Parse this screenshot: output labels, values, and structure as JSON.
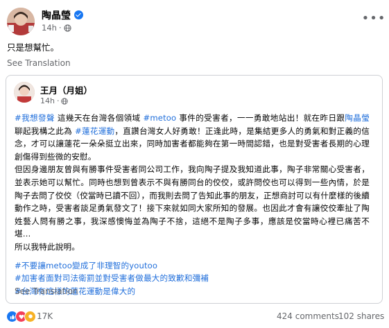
{
  "post": {
    "author": "陶晶瑩",
    "time": "14h",
    "text": "只是想幫忙。",
    "see_translation": "See Translation"
  },
  "shared": {
    "author": "王月（月姐）",
    "time": "14h",
    "body": {
      "p1": {
        "hashtag_1": "#我想發聲",
        "t1": " 這幾天在台灣各個領域 ",
        "hashtag_2": "#metoo",
        "t2": " 事件的受害者，一一勇敢地站出！就在昨日跟",
        "mention": "陶晶瑩",
        "t3": " 聊起我構之此為 ",
        "hashtag_3": "#蓮花運動",
        "t4": "，直讚台灣女人好勇敢！正逢此時，是集結更多人的勇氣和對正義的信念，才可以讓蓮花一朵朵挺立出來，同時加害者都能夠在第一時間認錯，也是對受害者長期的心理創傷得到些微的安慰。"
      },
      "p2": "但因身邊朋友曾與有勝事件受害者同公司工作，我向陶子提及我知道此事，陶子非常關心受害者，並表示她可以幫忙。同時也想到曾表示不與有勝同台的佼佼，或許問佼也可以得到一些內情，於是陶子去問了佼佼（佼當時已讀不回），而我則去問了告知此事的朋友，正想商討可以有什麼樣的後續動作之時，受害者談足勇氣發文了！接下來就如同大家所知的發展。也因此才會有讓佼佼牽扯了陶姓藝人問有勝之事，我深感懊悔並為陶子不捨，這絕不是陶子多事，應該是佼當時心裡已痛苦不堪…",
      "p3": "所以我特此說明。",
      "hashtags": [
        "#不要讓metoo變成了非理智的youtoo",
        "#加害者面對司法衛罰並對受害者做最大的致歉和彌補",
        "#台灣有這樣的蓮花運動是偉大的"
      ]
    },
    "see_translation": "See Translation"
  },
  "footer": {
    "reactions_count": "17K",
    "comments": "424 comments",
    "shares": "102 shares",
    "reaction_icons": [
      "like-icon",
      "heart-icon",
      "care-icon"
    ]
  },
  "colors": {
    "link": "#216fdb",
    "secondary": "#65676b",
    "verified": "#1877f2",
    "border": "#ced0d4"
  }
}
